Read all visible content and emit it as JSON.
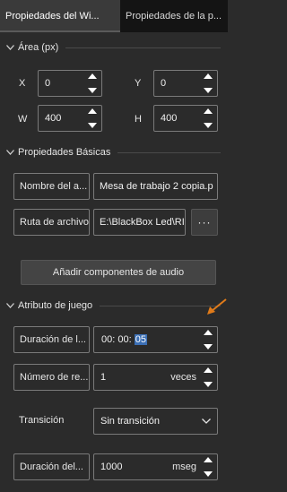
{
  "tabs": {
    "widget_props": "Propiedades del Wi...",
    "page_props": "Propiedades de la p..."
  },
  "area": {
    "section_title": "Área (px)",
    "x_label": "X",
    "x_value": "0",
    "y_label": "Y",
    "y_value": "0",
    "w_label": "W",
    "w_value": "400",
    "h_label": "H",
    "h_value": "400"
  },
  "basic": {
    "section_title": "Propiedades Básicas",
    "name_label": "Nombre del a...",
    "name_value": "Mesa de trabajo 2 copia.p",
    "path_label": "Ruta de archivo",
    "path_value": "E:\\BlackBox Led\\RI",
    "browse_label": "···",
    "add_audio_label": "Añadir componentes de audio"
  },
  "game": {
    "section_title": "Atributo de juego",
    "duration_label": "Duración de l...",
    "duration_prefix": "00: 00: ",
    "duration_seconds": "05",
    "repeat_label": "Número de re...",
    "repeat_value": "1",
    "repeat_unit": "veces",
    "transition_label": "Transición",
    "transition_value": "Sin transición",
    "trans_duration_label": "Duración del...",
    "trans_duration_value": "1000",
    "trans_duration_unit": "mseg"
  },
  "colors": {
    "background": "#2b2b2b",
    "highlight": "#3b6fb5",
    "annotation_arrow": "#e07b1a"
  }
}
